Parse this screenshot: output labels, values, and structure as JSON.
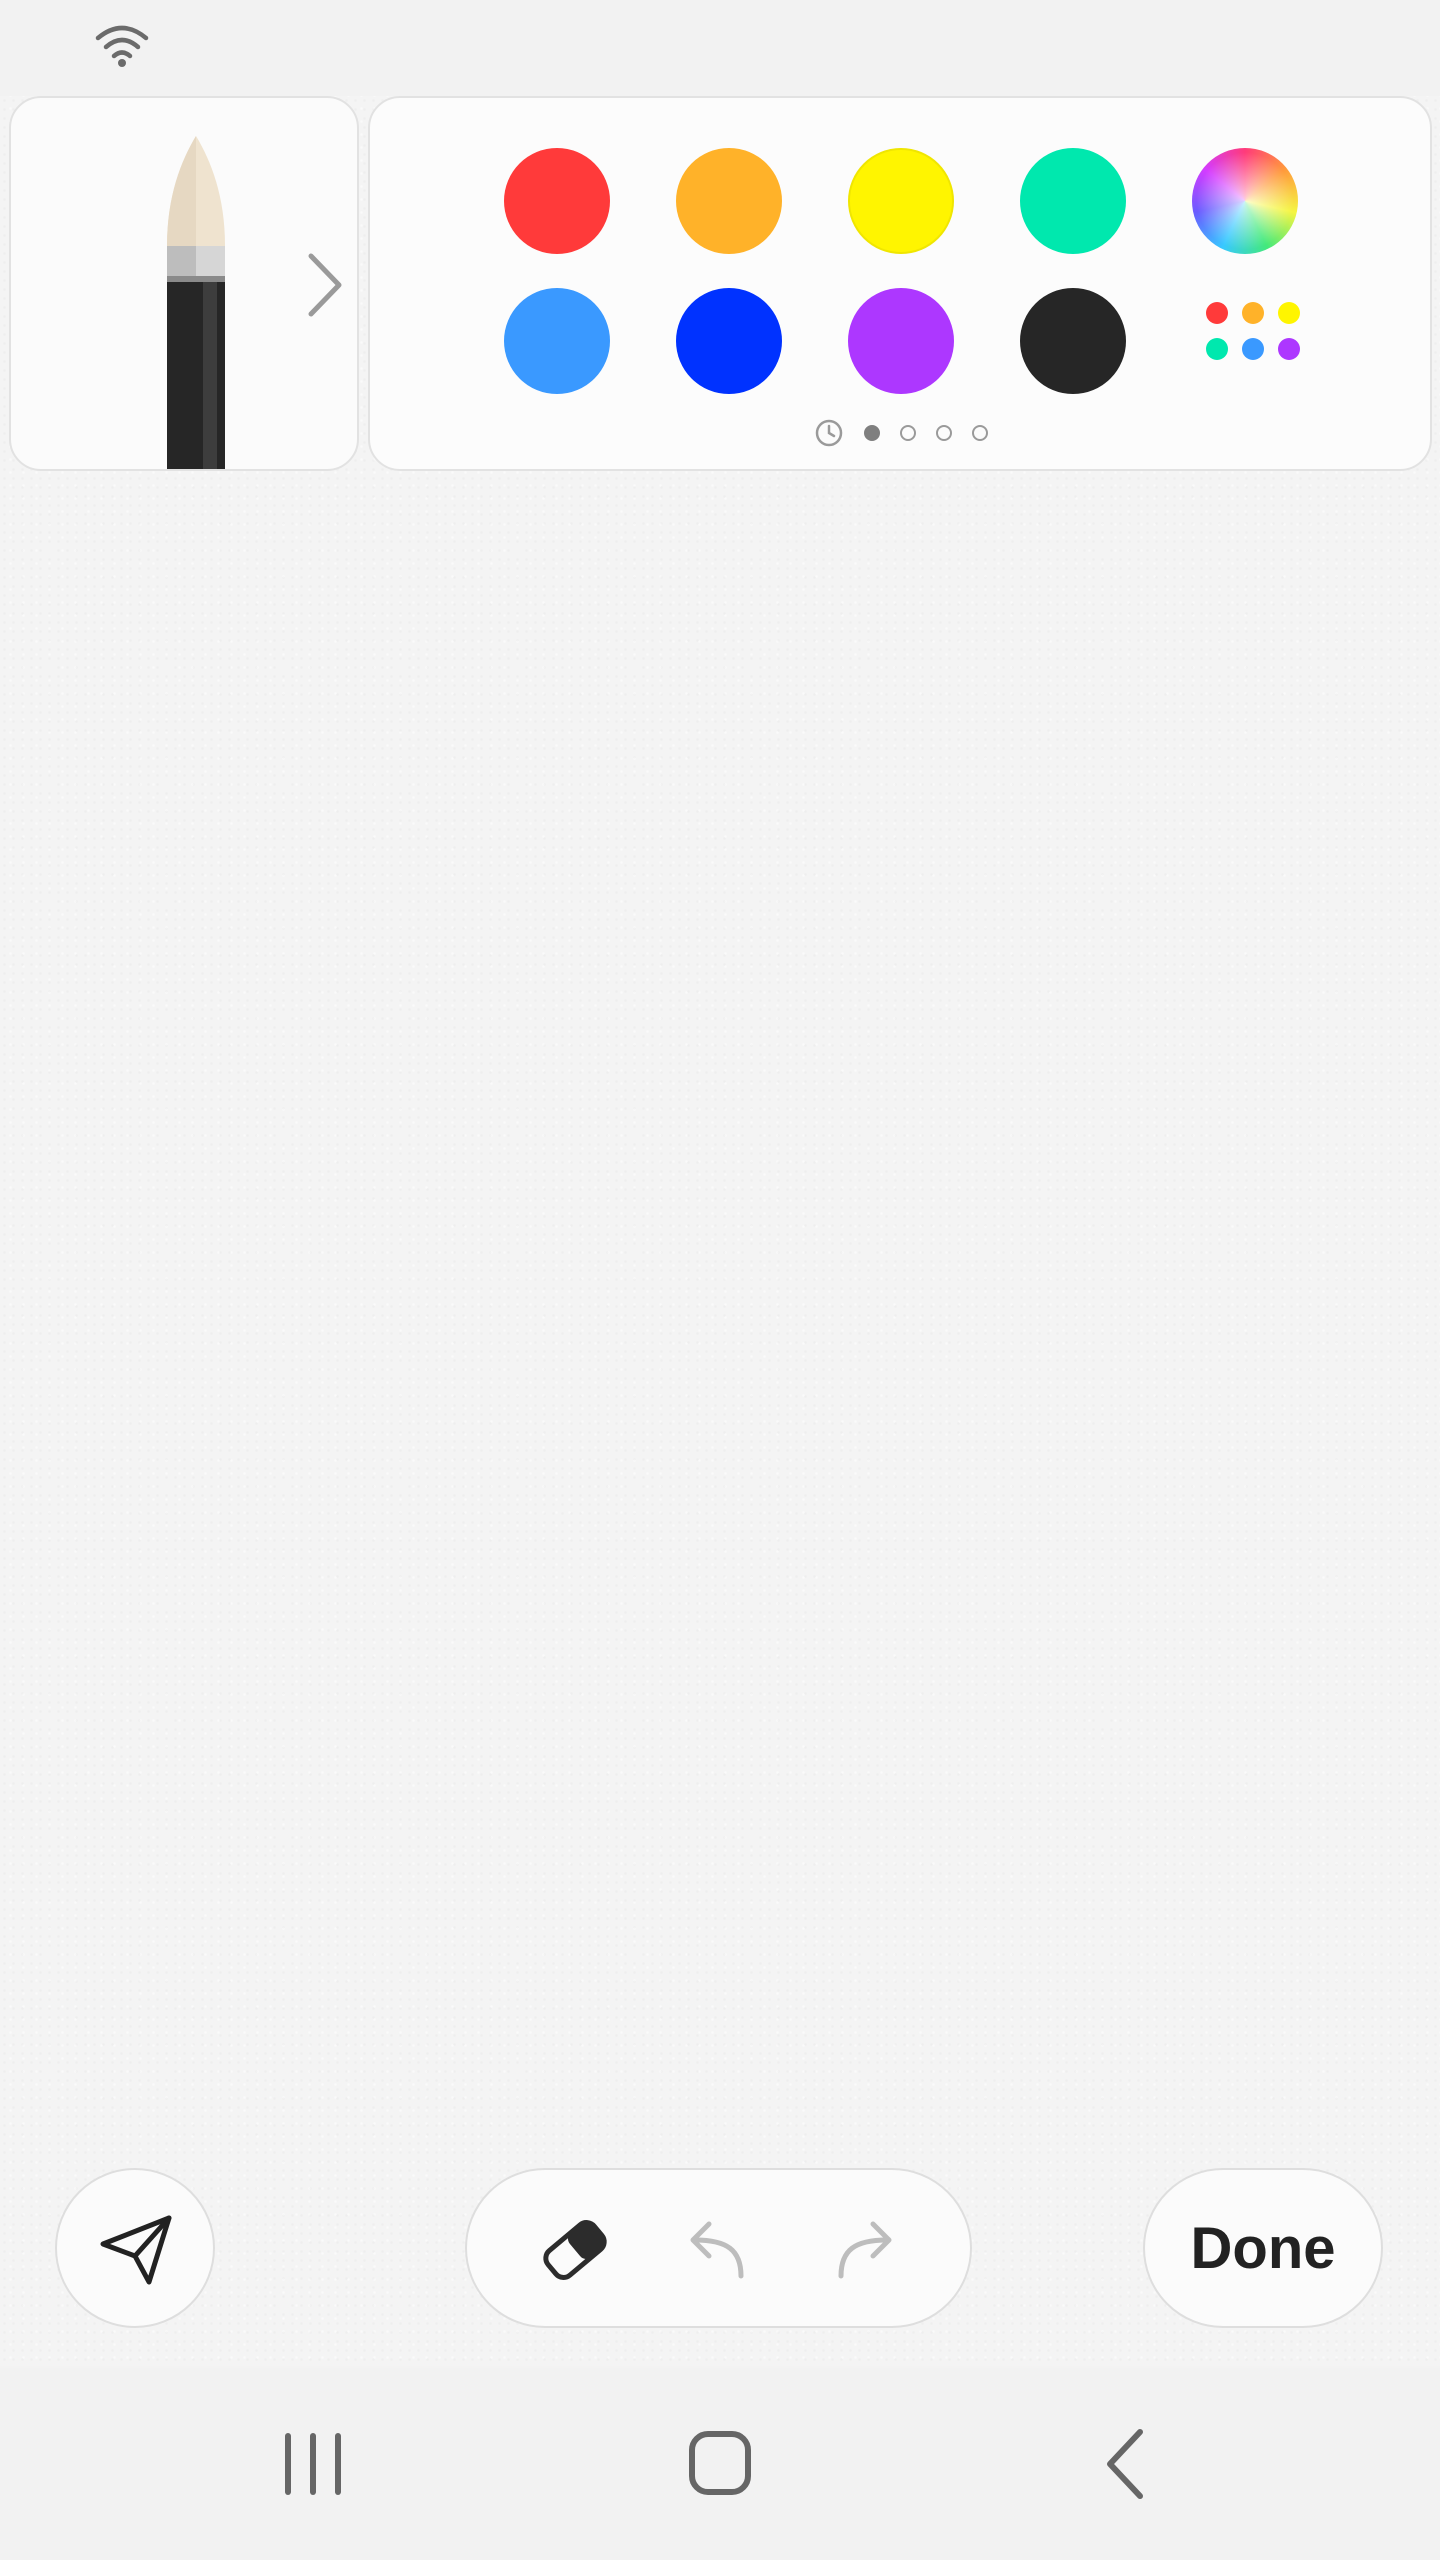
{
  "status_bar": {
    "icons": [
      "wifi-icon"
    ]
  },
  "pen_panel": {
    "icons": [
      "brush-icon",
      "chevron-right-icon"
    ]
  },
  "palette": {
    "colors": [
      "#ff3a3a",
      "#ffb229",
      "#fff500",
      "#00e8ae",
      "#3a99ff",
      "#0032ff",
      "#ad37ff",
      "#262626"
    ],
    "spectrum_icon": "color-spectrum-icon",
    "more_colors_dots": [
      "#ff3a3a",
      "#ffb229",
      "#fff500",
      "#00e8ae",
      "#3a99ff",
      "#ad37ff"
    ],
    "page_count": 4,
    "active_page": 1
  },
  "toolbar": {
    "icons": [
      "send-icon",
      "eraser-icon",
      "undo-icon",
      "redo-icon"
    ],
    "done_label": "Done"
  },
  "nav_bar": {
    "icons": [
      "recent-apps-icon",
      "home-icon",
      "back-icon"
    ]
  }
}
